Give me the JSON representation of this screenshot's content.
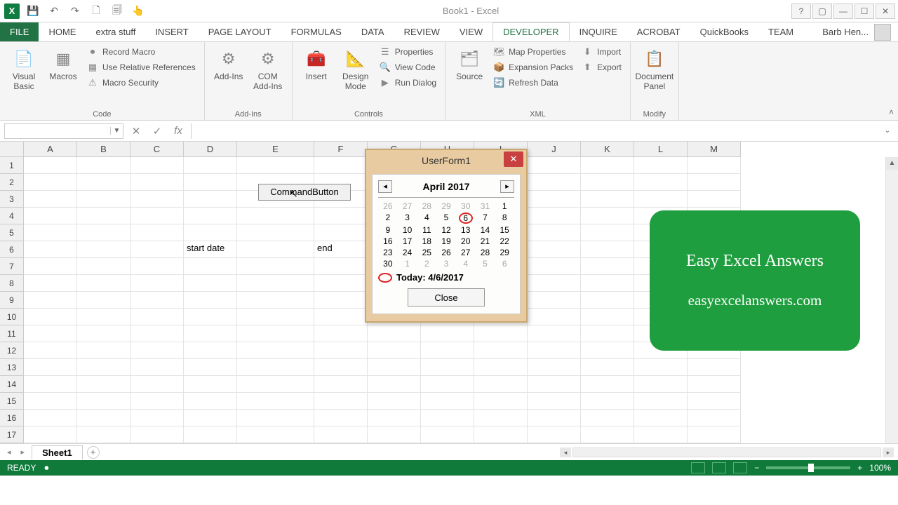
{
  "title": "Book1 - Excel",
  "qat": {
    "save": "💾",
    "undo": "↶",
    "redo": "↷",
    "new": "🗋",
    "open": "🗐",
    "touch": "👆"
  },
  "tabs": [
    "FILE",
    "HOME",
    "extra stuff",
    "INSERT",
    "PAGE LAYOUT",
    "FORMULAS",
    "DATA",
    "REVIEW",
    "VIEW",
    "DEVELOPER",
    "INQUIRE",
    "ACROBAT",
    "QuickBooks",
    "TEAM"
  ],
  "active_tab": "DEVELOPER",
  "user_name": "Barb Hen...",
  "ribbon": {
    "code": {
      "label": "Code",
      "visual_basic": "Visual Basic",
      "macros": "Macros",
      "record_macro": "Record Macro",
      "use_relative": "Use Relative References",
      "macro_security": "Macro Security"
    },
    "addins": {
      "label": "Add-Ins",
      "addins": "Add-Ins",
      "com": "COM Add-Ins"
    },
    "controls": {
      "label": "Controls",
      "insert": "Insert",
      "design": "Design Mode",
      "properties": "Properties",
      "view_code": "View Code",
      "run_dialog": "Run Dialog"
    },
    "xml": {
      "label": "XML",
      "source": "Source",
      "map_props": "Map Properties",
      "expansion": "Expansion Packs",
      "refresh": "Refresh Data",
      "import": "Import",
      "export": "Export"
    },
    "modify": {
      "label": "Modify",
      "doc_panel": "Document Panel"
    }
  },
  "formula_bar": {
    "fx": "fx",
    "cancel": "✕",
    "enter": "✓"
  },
  "columns": [
    "A",
    "B",
    "C",
    "D",
    "E",
    "F",
    "G",
    "H",
    "I",
    "J",
    "K",
    "L",
    "M"
  ],
  "rows": [
    "1",
    "2",
    "3",
    "4",
    "5",
    "6",
    "7",
    "8",
    "9",
    "10",
    "11",
    "12",
    "13",
    "14",
    "15",
    "16",
    "17"
  ],
  "cells": {
    "start_date": "start date",
    "end_date": "end",
    "command_button": "CommandButton"
  },
  "userform": {
    "title": "UserForm1",
    "month": "April 2017",
    "prev": "◂",
    "next": "▸",
    "today_label": "Today: 4/6/2017",
    "close": "Close",
    "weeks": [
      [
        {
          "d": "26",
          "g": true
        },
        {
          "d": "27",
          "g": true
        },
        {
          "d": "28",
          "g": true
        },
        {
          "d": "29",
          "g": true
        },
        {
          "d": "30",
          "g": true
        },
        {
          "d": "31",
          "g": true
        },
        {
          "d": "1"
        }
      ],
      [
        {
          "d": "2"
        },
        {
          "d": "3"
        },
        {
          "d": "4"
        },
        {
          "d": "5"
        },
        {
          "d": "6",
          "today": true
        },
        {
          "d": "7"
        },
        {
          "d": "8"
        }
      ],
      [
        {
          "d": "9"
        },
        {
          "d": "10"
        },
        {
          "d": "11"
        },
        {
          "d": "12"
        },
        {
          "d": "13"
        },
        {
          "d": "14"
        },
        {
          "d": "15"
        }
      ],
      [
        {
          "d": "16"
        },
        {
          "d": "17"
        },
        {
          "d": "18"
        },
        {
          "d": "19"
        },
        {
          "d": "20"
        },
        {
          "d": "21"
        },
        {
          "d": "22"
        }
      ],
      [
        {
          "d": "23"
        },
        {
          "d": "24"
        },
        {
          "d": "25"
        },
        {
          "d": "26"
        },
        {
          "d": "27"
        },
        {
          "d": "28"
        },
        {
          "d": "29"
        }
      ],
      [
        {
          "d": "30"
        },
        {
          "d": "1",
          "g": true
        },
        {
          "d": "2",
          "g": true
        },
        {
          "d": "3",
          "g": true
        },
        {
          "d": "4",
          "g": true
        },
        {
          "d": "5",
          "g": true
        },
        {
          "d": "6",
          "g": true
        }
      ]
    ]
  },
  "overlay": {
    "line1": "Easy Excel Answers",
    "line2": "easyexcelanswers.com"
  },
  "sheet_tabs": {
    "sheet1": "Sheet1",
    "add": "+"
  },
  "status": {
    "ready": "READY",
    "zoom": "100%"
  }
}
